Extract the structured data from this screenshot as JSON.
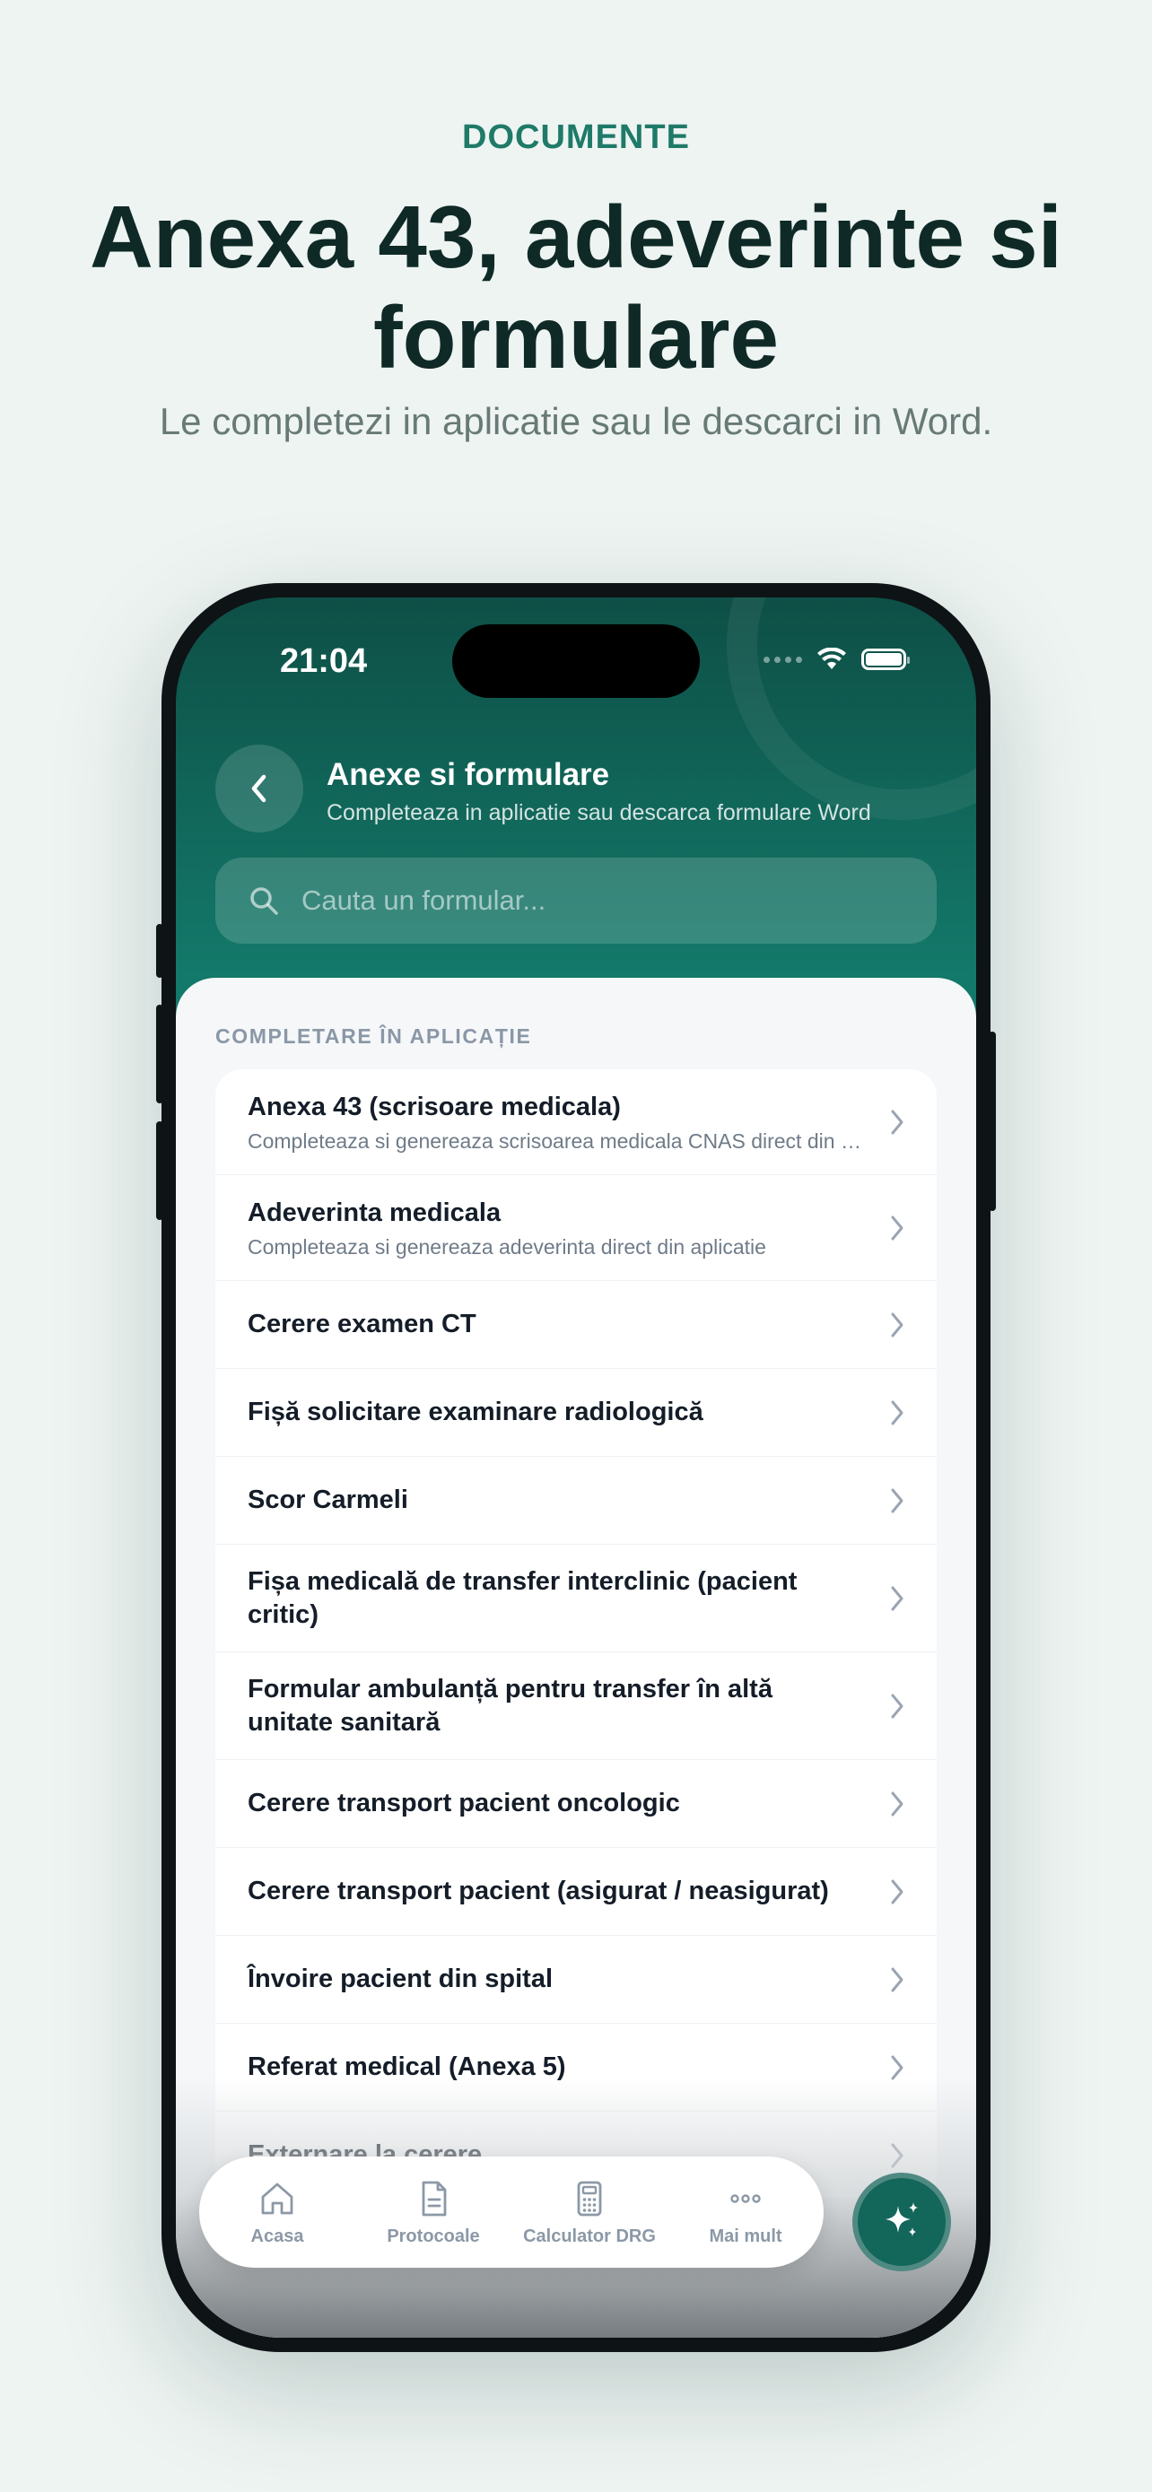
{
  "promo": {
    "eyebrow": "DOCUMENTE",
    "headline": "Anexa 43, adeverinte si formulare",
    "subhead": "Le completezi in aplicatie sau le descarci in Word."
  },
  "status_bar": {
    "time": "21:04"
  },
  "header": {
    "title": "Anexe si formulare",
    "subtitle": "Completeaza in aplicatie sau descarca formulare Word"
  },
  "search": {
    "placeholder": "Cauta un formular..."
  },
  "section": {
    "label": "COMPLETARE ÎN APLICAȚIE"
  },
  "forms": [
    {
      "title": "Anexa 43 (scrisoare medicala)",
      "desc": "Completeaza si genereaza scrisoarea medicala CNAS direct din aplicatie"
    },
    {
      "title": "Adeverinta medicala",
      "desc": "Completeaza si genereaza adeverinta direct din aplicatie"
    },
    {
      "title": "Cerere examen CT",
      "desc": ""
    },
    {
      "title": "Fișă solicitare examinare radiologică",
      "desc": ""
    },
    {
      "title": "Scor Carmeli",
      "desc": ""
    },
    {
      "title": "Fișa medicală de transfer interclinic (pacient critic)",
      "desc": ""
    },
    {
      "title": "Formular ambulanță pentru transfer în altă unitate sanitară",
      "desc": ""
    },
    {
      "title": "Cerere transport pacient oncologic",
      "desc": ""
    },
    {
      "title": "Cerere transport pacient (asigurat / neasigurat)",
      "desc": ""
    },
    {
      "title": "Învoire pacient din spital",
      "desc": ""
    },
    {
      "title": "Referat medical (Anexa 5)",
      "desc": ""
    },
    {
      "title": "Externare la cerere",
      "desc": ""
    }
  ],
  "tabbar": {
    "tabs": [
      {
        "label": "Acasa",
        "icon": "home-icon"
      },
      {
        "label": "Protocoale",
        "icon": "document-icon"
      },
      {
        "label": "Calculator DRG",
        "icon": "calculator-icon"
      },
      {
        "label": "Mai mult",
        "icon": "more-icon"
      }
    ],
    "fab_icon": "sparkles-icon"
  },
  "colors": {
    "accent": "#13796a",
    "headline": "#0f2a26",
    "eyebrow": "#1f7a68"
  }
}
